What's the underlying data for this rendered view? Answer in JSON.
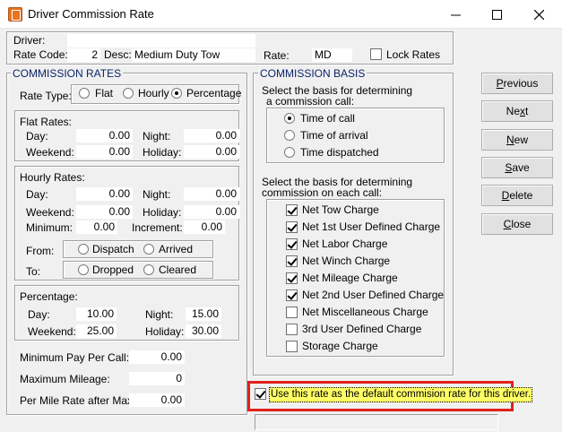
{
  "window": {
    "title": "Driver Commission Rate",
    "minimize_glyph": "—",
    "maximize_glyph": "☐",
    "close_glyph": "✕"
  },
  "header": {
    "driver_label": "Driver:",
    "driver_value": "",
    "rate_code_label": "Rate Code:",
    "rate_code_value": "2",
    "desc_label": "Desc:",
    "desc_value": "Medium Duty Tow",
    "rate_label": "Rate:",
    "rate_value": "MD",
    "lock_rates_label": "Lock Rates",
    "lock_rates_checked": false
  },
  "commission_rates": {
    "title": "COMMISSION RATES",
    "rate_type_label": "Rate Type:",
    "rate_types": [
      "Flat",
      "Hourly",
      "Percentage"
    ],
    "selected_rate_type": "Percentage",
    "flat": {
      "title": "Flat Rates:",
      "day_label": "Day:",
      "day": "0.00",
      "night_label": "Night:",
      "night": "0.00",
      "weekend_label": "Weekend:",
      "weekend": "0.00",
      "holiday_label": "Holiday:",
      "holiday": "0.00"
    },
    "hourly": {
      "title": "Hourly Rates:",
      "day_label": "Day:",
      "day": "0.00",
      "night_label": "Night:",
      "night": "0.00",
      "weekend_label": "Weekend:",
      "weekend": "0.00",
      "holiday_label": "Holiday:",
      "holiday": "0.00",
      "minimum_label": "Minimum:",
      "minimum": "0.00",
      "increment_label": "Increment:",
      "increment": "0.00",
      "from_label": "From:",
      "from_options": [
        "Dispatch",
        "Arrived"
      ],
      "to_label": "To:",
      "to_options": [
        "Dropped",
        "Cleared"
      ]
    },
    "percentage": {
      "title": "Percentage:",
      "day_label": "Day:",
      "day": "10.00",
      "night_label": "Night:",
      "night": "15.00",
      "weekend_label": "Weekend:",
      "weekend": "25.00",
      "holiday_label": "Holiday:",
      "holiday": "30.00"
    },
    "max_pay_label": "Minimum Pay Per Call:",
    "max_pay": "0.00",
    "max_mileage_label": "Maximum Mileage:",
    "max_mileage": "0",
    "per_mile_label": "Per Mile Rate after Max:",
    "per_mile": "0.00"
  },
  "commission_basis": {
    "title": "COMMISSION BASIS",
    "select_basis_label_1": "Select the basis for determining",
    "select_basis_label_2": "a commission call:",
    "call_options": [
      "Time of call",
      "Time of arrival",
      "Time dispatched"
    ],
    "selected_call_option": "Time of call",
    "each_call_label_1": "Select the basis for determining",
    "each_call_label_2": "commission on each call:",
    "charges": [
      {
        "label": "Net Tow Charge",
        "checked": true
      },
      {
        "label": "Net 1st User Defined Charge",
        "checked": true
      },
      {
        "label": "Net Labor Charge",
        "checked": true
      },
      {
        "label": "Net Winch Charge",
        "checked": true
      },
      {
        "label": "Net Mileage Charge",
        "checked": true
      },
      {
        "label": "Net 2nd User Defined Charge",
        "checked": true
      },
      {
        "label": "Net Miscellaneous Charge",
        "checked": false
      },
      {
        "label": "3rd User Defined Charge",
        "checked": false
      },
      {
        "label": "Storage Charge",
        "checked": false
      }
    ]
  },
  "buttons": [
    {
      "pre": "",
      "u": "P",
      "post": "revious",
      "name": "previous-button"
    },
    {
      "pre": "Ne",
      "u": "x",
      "post": "t",
      "name": "next-button"
    },
    {
      "pre": "",
      "u": "N",
      "post": "ew",
      "name": "new-button"
    },
    {
      "pre": "",
      "u": "S",
      "post": "ave",
      "name": "save-button"
    },
    {
      "pre": "",
      "u": "D",
      "post": "elete",
      "name": "delete-button"
    },
    {
      "pre": "",
      "u": "C",
      "post": "lose",
      "name": "close-button"
    }
  ],
  "default_rate": {
    "label": "Use this rate as the default commision rate for this driver.",
    "checked": true
  },
  "status_field": {
    "value": ""
  },
  "colors": {
    "highlight": "#ffff66",
    "callout": "#e0201e",
    "group_title": "#0a246a"
  }
}
